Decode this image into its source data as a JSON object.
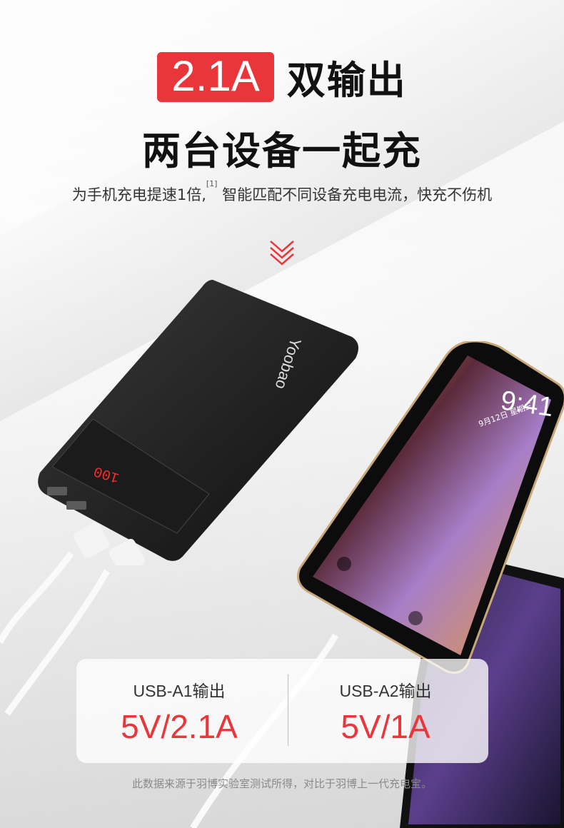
{
  "headline": {
    "badge": "2.1A",
    "title_line1": "双输出",
    "title_line2": "两台设备一起充"
  },
  "subtitle": {
    "text_before": "为手机充电提速1倍,",
    "footnote_ref": "[1]",
    "text_after": " 智能匹配不同设备充电电流，快充不伤机"
  },
  "product": {
    "brand": "Yoobao",
    "display_readout": "100",
    "phone_time": "9:41",
    "phone_date": "9月12日 星期三"
  },
  "outputs": [
    {
      "label": "USB-A1输出",
      "value": "5V/2.1A"
    },
    {
      "label": "USB-A2输出",
      "value": "5V/1A"
    }
  ],
  "footnote": "此数据来源于羽博实验室测试所得，对比于羽博上一代充电宝。",
  "colors": {
    "accent": "#e8363b"
  }
}
